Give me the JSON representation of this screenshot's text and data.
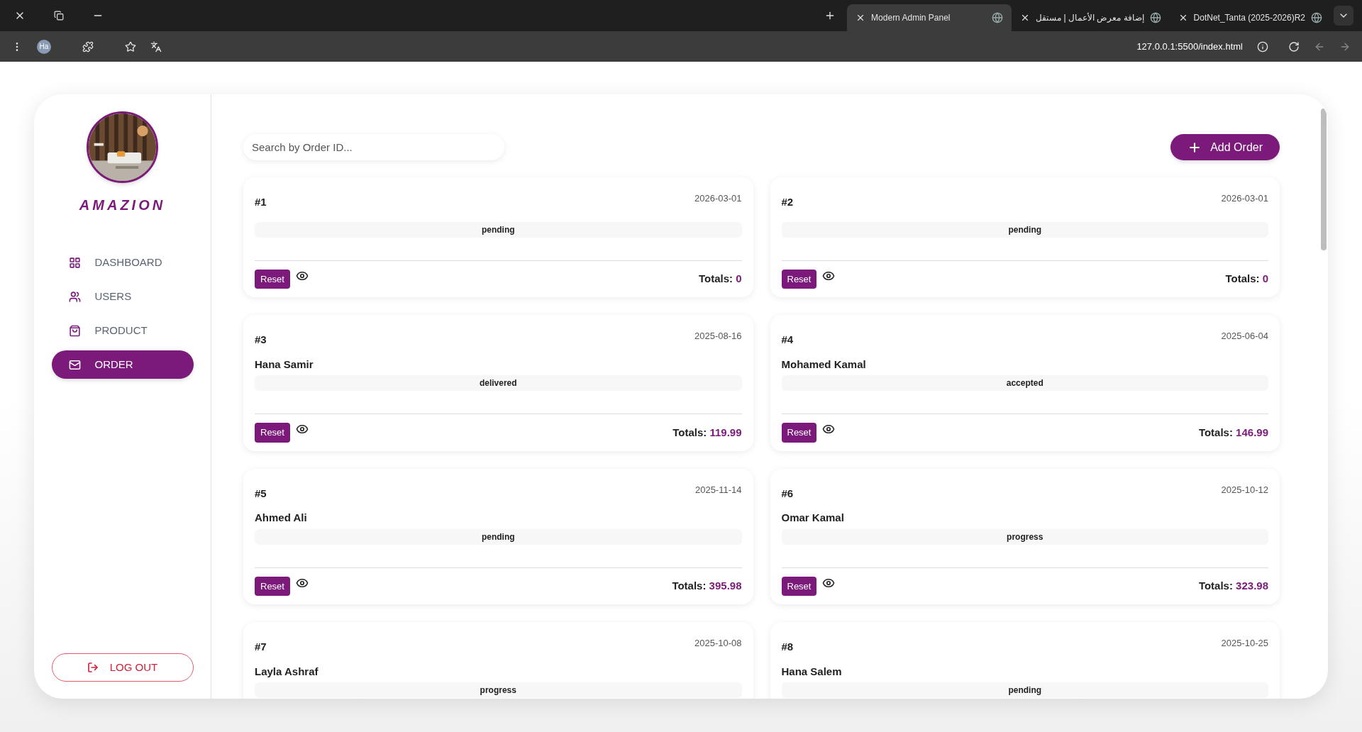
{
  "browser": {
    "tabs": [
      {
        "title": "Modern Admin Panel",
        "selected": true
      },
      {
        "title": "إضافة معرض الأعمال | مستقل",
        "selected": false
      },
      {
        "title": "DotNet_Tanta (2025-2026)R2",
        "selected": false
      }
    ],
    "profile": "Ha",
    "address": "127.0.0.1:5500/index.html"
  },
  "sidebar": {
    "brand": "AMAZION",
    "items": [
      {
        "label": "DASHBOARD",
        "selected": false
      },
      {
        "label": "USERS",
        "selected": false
      },
      {
        "label": "PRODUCT",
        "selected": false
      },
      {
        "label": "ORDER",
        "selected": true
      }
    ],
    "logout": "LOG OUT"
  },
  "search": {
    "placeholder": "Search by Order ID..."
  },
  "add_button": "Add Order",
  "orders": [
    {
      "id": "#1",
      "date": "2026-03-01",
      "status": "pending",
      "reset": "Reset",
      "totals_label": "Totals:",
      "total": "0"
    },
    {
      "id": "#2",
      "date": "2026-03-01",
      "status": "pending",
      "reset": "Reset",
      "totals_label": "Totals:",
      "total": "0"
    },
    {
      "id": "#3",
      "date": "2025-08-16",
      "customer": "Hana Samir",
      "status": "delivered",
      "reset": "Reset",
      "totals_label": "Totals:",
      "total": "119.99"
    },
    {
      "id": "#4",
      "date": "2025-06-04",
      "customer": "Mohamed Kamal",
      "status": "accepted",
      "reset": "Reset",
      "totals_label": "Totals:",
      "total": "146.99"
    },
    {
      "id": "#5",
      "date": "2025-11-14",
      "customer": "Ahmed Ali",
      "status": "pending",
      "reset": "Reset",
      "totals_label": "Totals:",
      "total": "395.98"
    },
    {
      "id": "#6",
      "date": "2025-10-12",
      "customer": "Omar Kamal",
      "status": "progress",
      "reset": "Reset",
      "totals_label": "Totals:",
      "total": "323.98"
    },
    {
      "id": "#7",
      "date": "2025-10-08",
      "customer": "Layla Ashraf",
      "status": "progress"
    },
    {
      "id": "#8",
      "date": "2025-10-25",
      "customer": "Hana Salem",
      "status": "pending"
    }
  ]
}
